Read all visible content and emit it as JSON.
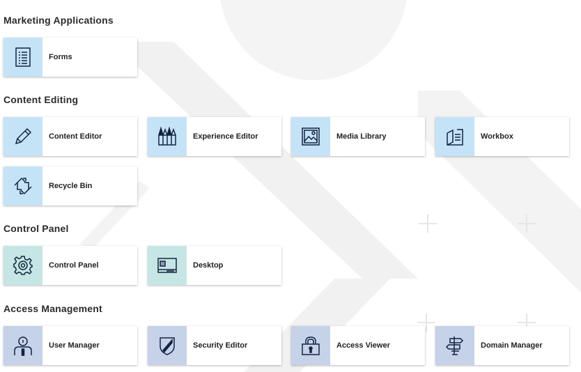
{
  "colors": {
    "icon_blue": "#c5e3f6",
    "icon_teal": "#c5e6e4",
    "icon_slate": "#c6d2e8",
    "icon_stroke": "#14233f",
    "background_shapes": "#f3f3f3"
  },
  "sections": {
    "marketing": {
      "title": "Marketing Applications",
      "tiles": [
        {
          "label": "Forms",
          "icon": "forms-icon",
          "icon_color": "#c5e3f6"
        }
      ]
    },
    "content": {
      "title": "Content Editing",
      "tiles": [
        {
          "label": "Content Editor",
          "icon": "pencil-icon",
          "icon_color": "#c5e3f6"
        },
        {
          "label": "Experience Editor",
          "icon": "pencils-icon",
          "icon_color": "#c5e3f6"
        },
        {
          "label": "Media Library",
          "icon": "image-icon",
          "icon_color": "#c5e3f6"
        },
        {
          "label": "Workbox",
          "icon": "workbox-icon",
          "icon_color": "#c5e3f6"
        },
        {
          "label": "Recycle Bin",
          "icon": "recycle-icon",
          "icon_color": "#c5e3f6"
        }
      ]
    },
    "control": {
      "title": "Control Panel",
      "tiles": [
        {
          "label": "Control Panel",
          "icon": "gear-icon",
          "icon_color": "#c5e6e4"
        },
        {
          "label": "Desktop",
          "icon": "desktop-icon",
          "icon_color": "#c5e6e4"
        }
      ]
    },
    "access": {
      "title": "Access Management",
      "tiles": [
        {
          "label": "User Manager",
          "icon": "user-icon",
          "icon_color": "#c6d2e8"
        },
        {
          "label": "Security Editor",
          "icon": "shield-icon",
          "icon_color": "#c6d2e8"
        },
        {
          "label": "Access Viewer",
          "icon": "lock-icon",
          "icon_color": "#c6d2e8"
        },
        {
          "label": "Domain Manager",
          "icon": "signpost-icon",
          "icon_color": "#c6d2e8"
        }
      ]
    }
  }
}
